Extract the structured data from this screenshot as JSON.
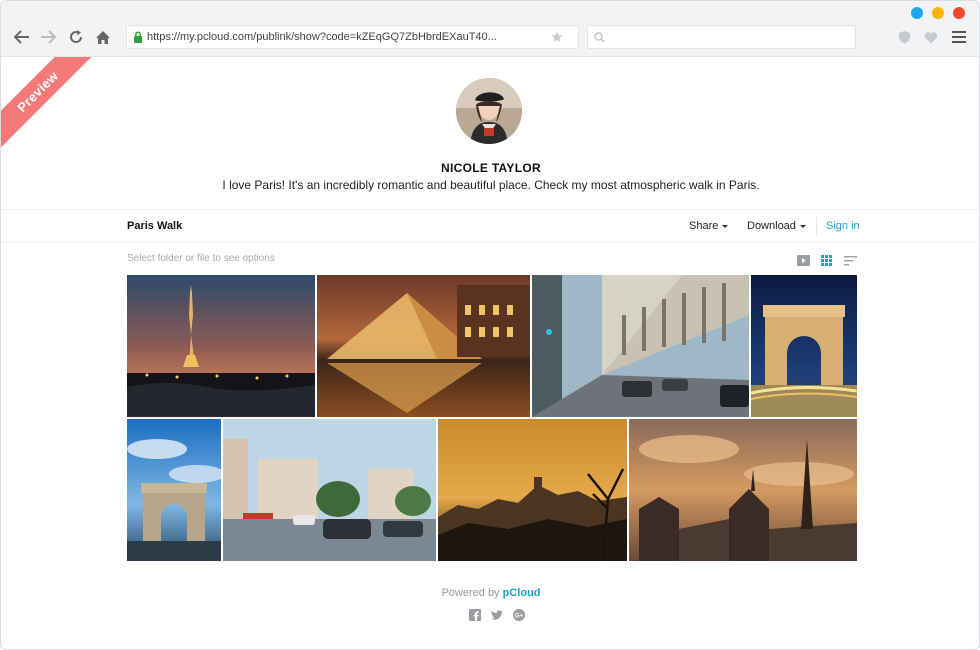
{
  "browser": {
    "url": "https://my.pcloud.com/publink/show?code=kZEqGQ7ZbHbrdEXauT40...",
    "search_placeholder": "",
    "dot_colors": [
      "#1aa7ec",
      "#f6b500",
      "#ee4a2a"
    ]
  },
  "ribbon": {
    "label": "Preview",
    "color": "#f47a7a"
  },
  "profile": {
    "name": "NICOLE TAYLOR",
    "bio": "I love Paris! It's an incredibly romantic and beautiful place. Check my most atmospheric walk in Paris."
  },
  "toolbar": {
    "folder_title": "Paris Walk",
    "share_label": "Share",
    "download_label": "Download",
    "signin_label": "Sign in",
    "hint": "Select folder or file to see options"
  },
  "gallery": {
    "photos": [
      "eiffel-tower-sunset",
      "louvre-pyramid-night",
      "paris-street-cars",
      "arc-de-triomphe-night",
      "arc-de-triomphe-sky",
      "paris-boulevard-traffic",
      "paris-golden-fog",
      "notre-dame-sunset"
    ]
  },
  "footer": {
    "powered_by": "Powered by",
    "brand": "pCloud",
    "social_icons": [
      "facebook-icon",
      "twitter-icon",
      "google-plus-icon"
    ]
  },
  "colors": {
    "accent": "#17a2c6"
  }
}
